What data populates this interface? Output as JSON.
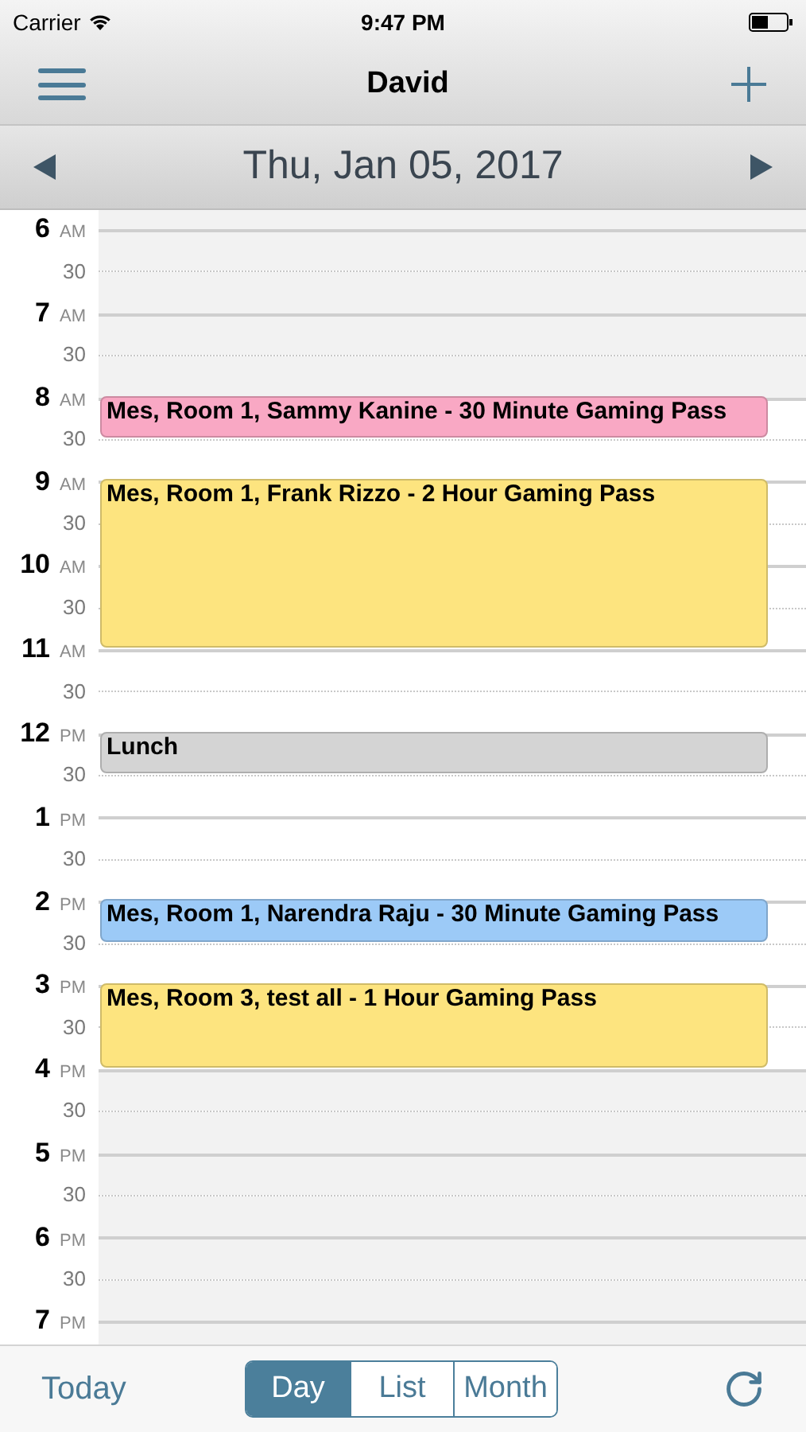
{
  "status_bar": {
    "carrier": "Carrier",
    "time": "9:47 PM"
  },
  "nav": {
    "title": "David"
  },
  "date_bar": {
    "date": "Thu, Jan 05, 2017"
  },
  "slots": [
    {
      "kind": "hour",
      "hour": "6",
      "period": "AM",
      "shaded": true
    },
    {
      "kind": "half",
      "label": "30",
      "shaded": true
    },
    {
      "kind": "hour",
      "hour": "7",
      "period": "AM",
      "shaded": true
    },
    {
      "kind": "half",
      "label": "30",
      "shaded": true
    },
    {
      "kind": "hour",
      "hour": "8",
      "period": "AM",
      "shaded": false,
      "event": {
        "title": "Mes, Room 1, Sammy Kanine - 30 Minute Gaming Pass",
        "color": "#f9a8c4",
        "kind": "half_hour"
      }
    },
    {
      "kind": "half",
      "label": "30",
      "shaded": false
    },
    {
      "kind": "hour",
      "hour": "9",
      "period": "AM",
      "shaded": false,
      "event": {
        "title": "Mes, Room 1, Frank Rizzo - 2 Hour Gaming Pass",
        "color": "#fde47f",
        "kind": "two_hours"
      }
    },
    {
      "kind": "half",
      "label": "30",
      "shaded": false
    },
    {
      "kind": "hour",
      "hour": "10",
      "period": "AM",
      "shaded": false
    },
    {
      "kind": "half",
      "label": "30",
      "shaded": false
    },
    {
      "kind": "hour",
      "hour": "11",
      "period": "AM",
      "shaded": false
    },
    {
      "kind": "half",
      "label": "30",
      "shaded": false
    },
    {
      "kind": "hour",
      "hour": "12",
      "period": "PM",
      "shaded": false,
      "event": {
        "title": "Lunch",
        "color": "#d4d4d4",
        "kind": "half_hour"
      }
    },
    {
      "kind": "half",
      "label": "30",
      "shaded": false
    },
    {
      "kind": "hour",
      "hour": "1",
      "period": "PM",
      "shaded": false
    },
    {
      "kind": "half",
      "label": "30",
      "shaded": false
    },
    {
      "kind": "hour",
      "hour": "2",
      "period": "PM",
      "shaded": false,
      "event": {
        "title": "Mes, Room 1, Narendra Raju - 30 Minute Gaming Pass",
        "color": "#9ccaf7",
        "kind": "half_hour"
      }
    },
    {
      "kind": "half",
      "label": "30",
      "shaded": false
    },
    {
      "kind": "hour",
      "hour": "3",
      "period": "PM",
      "shaded": false,
      "event": {
        "title": "Mes, Room 3, test all - 1 Hour Gaming Pass",
        "color": "#fde47f",
        "kind": "one_hour"
      }
    },
    {
      "kind": "half",
      "label": "30",
      "shaded": false
    },
    {
      "kind": "hour",
      "hour": "4",
      "period": "PM",
      "shaded": true
    },
    {
      "kind": "half",
      "label": "30",
      "shaded": true
    },
    {
      "kind": "hour",
      "hour": "5",
      "period": "PM",
      "shaded": true
    },
    {
      "kind": "half",
      "label": "30",
      "shaded": true
    },
    {
      "kind": "hour",
      "hour": "6",
      "period": "PM",
      "shaded": true
    },
    {
      "kind": "half",
      "label": "30",
      "shaded": true
    },
    {
      "kind": "hour",
      "hour": "7",
      "period": "PM",
      "shaded": true
    }
  ],
  "toolbar": {
    "today": "Today",
    "views": [
      {
        "label": "Day",
        "selected": true
      },
      {
        "label": "List",
        "selected": false
      },
      {
        "label": "Month",
        "selected": false
      }
    ]
  }
}
